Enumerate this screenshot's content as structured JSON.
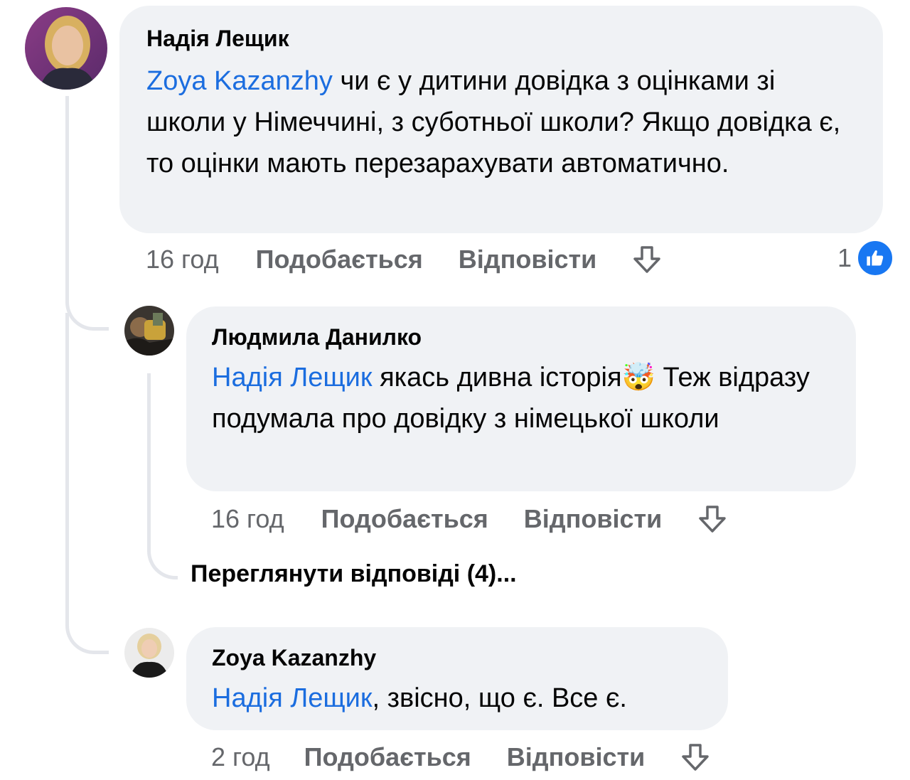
{
  "comments": [
    {
      "author": "Надія Лещик",
      "mention": "Zoya Kazanzhy",
      "text": " чи є у дитини довідка з оцінками зі школи у Німеччині, з суботньої школи? Якщо довідка є, то оцінки мають перезарахувати автоматично.",
      "time": "16 год",
      "like_label": "Подобається",
      "reply_label": "Відповісти",
      "reaction_count": "1"
    },
    {
      "author": "Людмила Данилко",
      "mention": "Надія Лещик",
      "text_before_emoji": " якась дивна історія",
      "emoji": "🤯",
      "text_after_emoji": " Теж відразу подумала про довідку з німецької школи",
      "time": "16 год",
      "like_label": "Подобається",
      "reply_label": "Відповісти"
    },
    {
      "author": "Zoya Kazanzhy",
      "mention": "Надія Лещик",
      "text": ", звісно, що є. Все є.",
      "time": "2 год",
      "like_label": "Подобається",
      "reply_label": "Відповісти"
    }
  ],
  "view_replies": "Переглянути відповіді (4)...",
  "icons": {
    "share": "share-arrow-icon",
    "like": "thumbs-up-icon"
  },
  "colors": {
    "mention": "#1b6ddf",
    "bubble": "#f0f2f5",
    "meta": "#65676b",
    "like_badge": "#1877f2"
  }
}
